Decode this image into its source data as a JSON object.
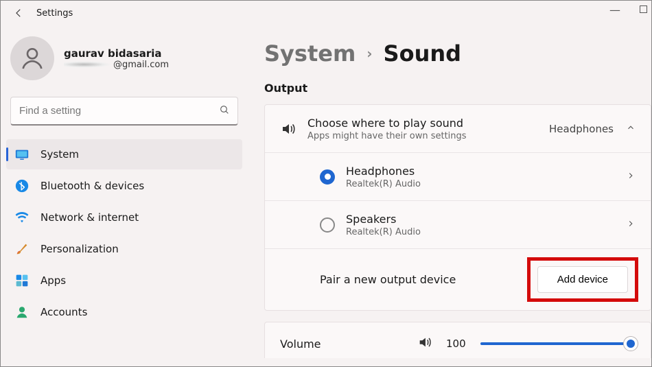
{
  "titlebar": {
    "title": "Settings"
  },
  "profile": {
    "name": "gaurav bidasaria",
    "email_suffix": "@gmail.com"
  },
  "search": {
    "placeholder": "Find a setting"
  },
  "nav": {
    "items": [
      {
        "label": "System",
        "active": true
      },
      {
        "label": "Bluetooth & devices"
      },
      {
        "label": "Network & internet"
      },
      {
        "label": "Personalization"
      },
      {
        "label": "Apps"
      },
      {
        "label": "Accounts"
      }
    ]
  },
  "breadcrumb": {
    "parent": "System",
    "current": "Sound"
  },
  "output": {
    "section": "Output",
    "choose": {
      "title": "Choose where to play sound",
      "sub": "Apps might have their own settings",
      "trail": "Headphones"
    },
    "devices": [
      {
        "name": "Headphones",
        "driver": "Realtek(R) Audio",
        "selected": true
      },
      {
        "name": "Speakers",
        "driver": "Realtek(R) Audio",
        "selected": false
      }
    ],
    "pair": {
      "label": "Pair a new output device",
      "button": "Add device"
    }
  },
  "volume": {
    "label": "Volume",
    "value": "100"
  }
}
